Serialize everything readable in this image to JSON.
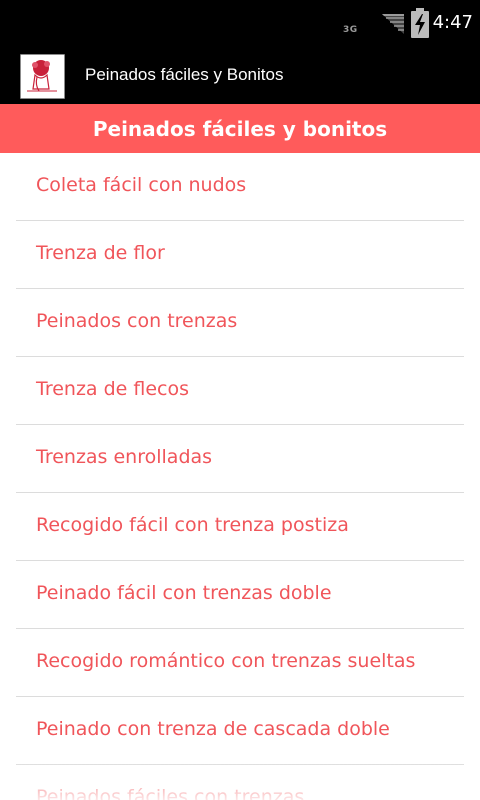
{
  "status_bar": {
    "network": "3G",
    "time": "4:47"
  },
  "action_bar": {
    "title": "Peinados fáciles y Bonitos",
    "icon": "hairstyle-logo-icon"
  },
  "header": {
    "title": "Peinados fáciles y bonitos"
  },
  "list": {
    "items": [
      {
        "label": "Coleta fácil con nudos"
      },
      {
        "label": "Trenza de flor"
      },
      {
        "label": "Peinados con trenzas"
      },
      {
        "label": "Trenza de flecos"
      },
      {
        "label": "Trenzas enrolladas"
      },
      {
        "label": "Recogido fácil con trenza postiza"
      },
      {
        "label": "Peinado fácil con trenzas doble"
      },
      {
        "label": "Recogido romántico con trenzas sueltas"
      },
      {
        "label": "Peinado con trenza de cascada doble"
      },
      {
        "label": "Peinados fáciles con trenzas"
      }
    ]
  },
  "colors": {
    "accent": "#ff5b5b",
    "item_text": "#f0555a"
  }
}
